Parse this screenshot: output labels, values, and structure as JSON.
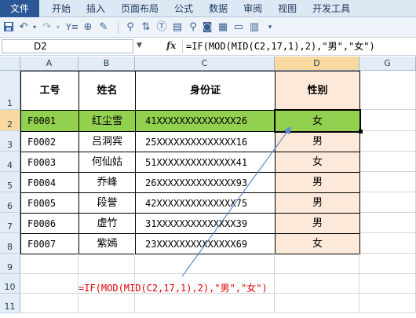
{
  "ribbon": {
    "tabs": [
      "文件",
      "开始",
      "插入",
      "页面布局",
      "公式",
      "数据",
      "审阅",
      "视图",
      "开发工具"
    ]
  },
  "toolbar": {
    "icons": [
      "save-icon",
      "undo-icon",
      "redo-icon",
      "filter-icon",
      "zoom-icon",
      "format-painter-icon",
      "find-icon",
      "camera-icon",
      "print-preview-icon",
      "customize-icon"
    ]
  },
  "formula_bar": {
    "name_box": "D2",
    "fx_label": "fx",
    "formula": "=IF(MOD(MID(C2,17,1),2),\"男\",\"女\")"
  },
  "sheet": {
    "columns": [
      "A",
      "B",
      "C",
      "D",
      "G"
    ],
    "rows": [
      "1",
      "2",
      "3",
      "4",
      "5",
      "6",
      "7",
      "8",
      "9",
      "10",
      "11"
    ],
    "headers": {
      "id": "工号",
      "name": "姓名",
      "idcard": "身份证",
      "gender": "性别"
    },
    "records": [
      {
        "id": "F0001",
        "name": "红尘雪",
        "idcard": "41XXXXXXXXXXXXXX26",
        "gender": "女"
      },
      {
        "id": "F0002",
        "name": "吕洞宾",
        "idcard": "25XXXXXXXXXXXXXX16",
        "gender": "男"
      },
      {
        "id": "F0003",
        "name": "何仙姑",
        "idcard": "51XXXXXXXXXXXXXX41",
        "gender": "女"
      },
      {
        "id": "F0004",
        "name": "乔峰",
        "idcard": "26XXXXXXXXXXXXXX93",
        "gender": "男"
      },
      {
        "id": "F0005",
        "name": "段誉",
        "idcard": "42XXXXXXXXXXXXXX75",
        "gender": "男"
      },
      {
        "id": "F0006",
        "name": "虚竹",
        "idcard": "31XXXXXXXXXXXXXX39",
        "gender": "男"
      },
      {
        "id": "F0007",
        "name": "紫嫣",
        "idcard": "23XXXXXXXXXXXXXX69",
        "gender": "女"
      }
    ],
    "annotation": "=IF(MOD(MID(C2,17,1),2),\"男\",\"女\")"
  },
  "colors": {
    "highlight_row": "#92d050",
    "gender_fill": "#fde9d9",
    "annotation_text": "#e00000",
    "arrow": "#5b8dc9"
  }
}
